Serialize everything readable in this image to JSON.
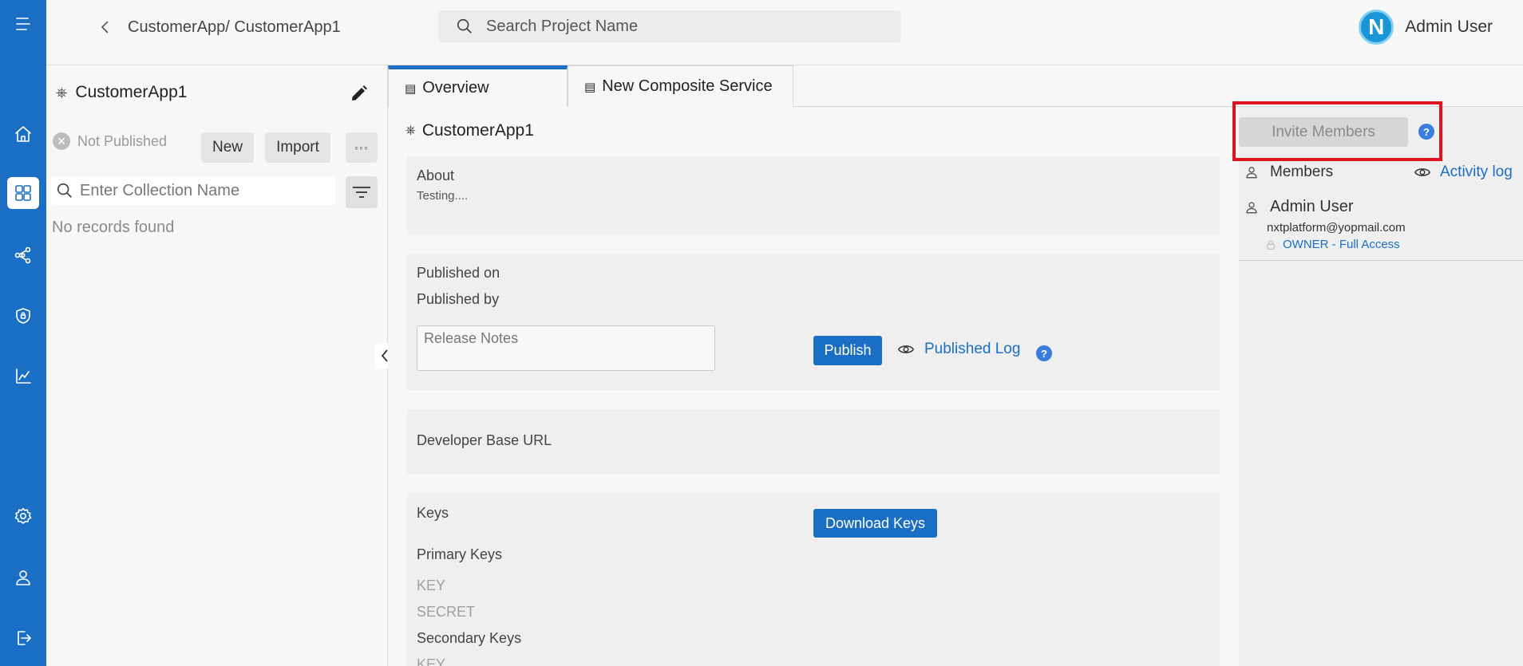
{
  "header": {
    "breadcrumb": "CustomerApp/ CustomerApp1",
    "search_placeholder": "Search Project Name",
    "avatar_letter": "N",
    "user_name": "Admin User"
  },
  "rail": {
    "icons": [
      "menu-icon",
      "home-icon",
      "dashboard-icon",
      "share-icon",
      "shield-icon",
      "analytics-icon",
      "settings-icon",
      "user-icon",
      "logout-icon"
    ],
    "active": "dashboard-icon"
  },
  "collections": {
    "app_name": "CustomerApp1",
    "status": "Not Published",
    "new_label": "New",
    "import_label": "Import",
    "more_label": "◦◦◦",
    "search_placeholder": "Enter Collection Name",
    "empty_text": "No records found"
  },
  "tabs": [
    {
      "label": "Overview",
      "active": true
    },
    {
      "label": "New Composite Service",
      "active": false
    }
  ],
  "overview": {
    "title": "CustomerApp1",
    "about_label": "About",
    "about_text": "Testing....",
    "published_on_label": "Published on",
    "published_by_label": "Published by",
    "release_notes_placeholder": "Release Notes",
    "publish_label": "Publish",
    "published_log_label": "Published Log",
    "dev_base_url_label": "Developer Base URL",
    "keys_label": "Keys",
    "download_keys_label": "Download Keys",
    "primary_keys_label": "Primary Keys",
    "key_label": "KEY",
    "secret_label": "SECRET",
    "secondary_keys_label": "Secondary Keys",
    "secondary_key_label": "KEY"
  },
  "members": {
    "invite_label": "Invite Members",
    "members_label": "Members",
    "activity_log_label": "Activity log",
    "list": [
      {
        "name": "Admin User",
        "email": "nxtplatform@yopmail.com",
        "role": "OWNER - Full Access"
      }
    ]
  },
  "colors": {
    "brand": "#1a6fc4",
    "highlight": "#e0141e",
    "help": "#3a7de0"
  }
}
